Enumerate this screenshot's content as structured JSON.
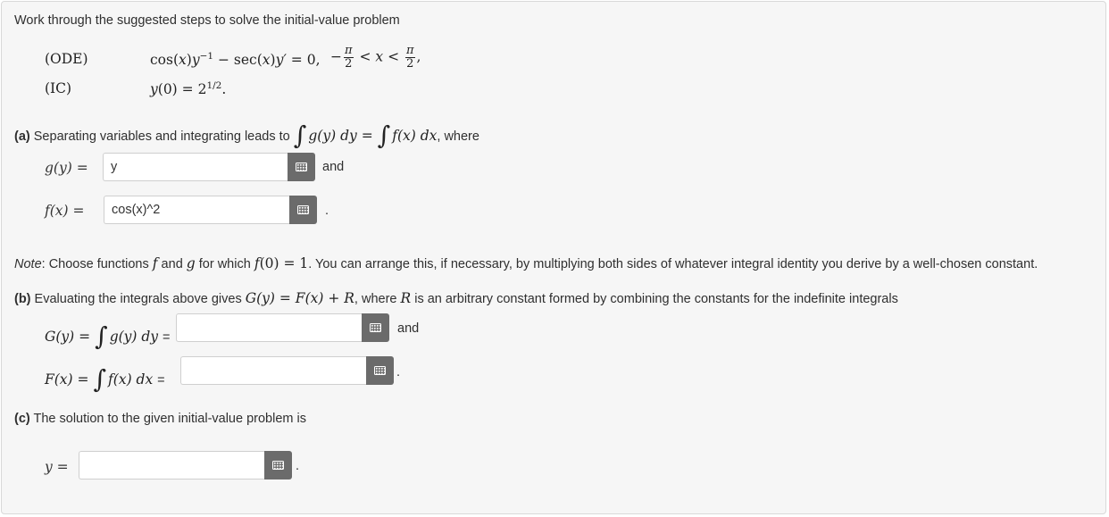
{
  "intro": "Work through the suggested steps to solve the initial-value problem",
  "ode_label": "(ODE)",
  "ic_label": "(IC)",
  "ode": {
    "t1": "cos(",
    "t2": "x",
    "t3": ")",
    "t4": "y",
    "t5": "−1",
    "t6": " − sec(",
    "t7": "x",
    "t8": ")",
    "t9": "y′",
    "t10": " = 0,",
    "neg": "−",
    "pi": "π",
    "two": "2",
    "lt1": " < ",
    "x": "x",
    "lt2": " < ",
    "comma": ","
  },
  "ic": {
    "lhs": "y",
    "rest": "(0) = 2",
    "exp": "1/2",
    "end": "."
  },
  "part_a": {
    "tag": "(a)",
    "text": " Separating variables and integrating leads to ",
    "int1": "∫",
    "g_y": "g",
    "g_arg": "(y) dy",
    "eq": " = ",
    "int2": "∫",
    "f_x": "f",
    "f_arg": "(x) dx",
    "where": ", where",
    "g_label": "g(y) =",
    "g_value": "y",
    "and": "and",
    "f_label": "f(x) =",
    "f_value": "cos(x)^2",
    "period": "."
  },
  "note": {
    "label": "Note",
    "t1": ": Choose functions ",
    "f": "f",
    "t2": " and ",
    "g": "g",
    "t3": " for which ",
    "f0": "f",
    "t4": "(0) = 1",
    "t5": ". You can arrange this, if necessary, by multiplying both sides of whatever integral identity you derive by a well-chosen constant."
  },
  "part_b": {
    "tag": "(b)",
    "t1": " Evaluating the integrals above gives ",
    "eqn": "G(y) = F(x) + R",
    "t2": ", where ",
    "R": "R",
    "t3": " is an arbitrary constant formed by combining the constants for the indefinite integrals",
    "G_label": "G(y) =",
    "G_int": "∫",
    "G_rest": "g(y) dy",
    "G_eq": "=",
    "and": "and",
    "F_label": "F(x) =",
    "F_int": "∫",
    "F_rest": "f(x) dx",
    "F_eq": "=",
    "G_value": "",
    "F_value": "",
    "period": "."
  },
  "part_c": {
    "tag": "(c)",
    "text": " The solution to the given initial-value problem is",
    "y_label": "y =",
    "y_value": "",
    "period": "."
  }
}
